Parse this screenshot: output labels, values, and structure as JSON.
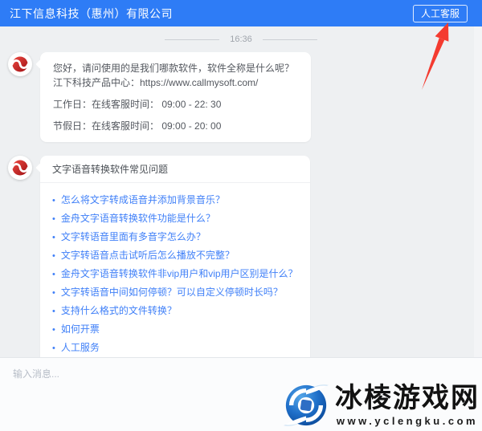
{
  "colors": {
    "header_bg": "#2e7cf6",
    "chat_bg": "#eef0f2",
    "link": "#4080f8",
    "arrow": "#f43b30"
  },
  "header": {
    "title": "江下信息科技（惠州）有限公司",
    "agent_button_label": "人工客服"
  },
  "chat": {
    "timestamp": "16:36",
    "greeting_message": {
      "paragraphs": [
        "您好，请问使用的是我们哪款软件，软件全称是什么呢？江下科技产品中心：https://www.callmysoft.com/",
        "工作日：在线客服时间： 09:00 - 22: 30",
        "节假日：在线客服时间： 09:00 - 20: 00"
      ]
    },
    "faq_message": {
      "title": "文字语音转换软件常见问题",
      "links": [
        "怎么将文字转成语音并添加背景音乐？",
        "金舟文字语音转换软件功能是什么？",
        "文字转语音里面有多音字怎么办？",
        "文字转语音点击试听后怎么播放不完整？",
        "金舟文字语音转换软件非vip用户和vip用户区别是什么？",
        "文字转语音中间如何停顿？可以自定义停顿时长吗？",
        "支持什么格式的文件转换？",
        "如何开票",
        "人工服务"
      ]
    }
  },
  "composer": {
    "placeholder": "输入消息..."
  },
  "watermark": {
    "site_name": "冰棱游戏网",
    "site_url": "www.yclengku.com"
  },
  "icons": {
    "avatar": "jiangxia-red-swirl-logo",
    "watermark_logo": "yclengku-blue-globe-logo"
  }
}
